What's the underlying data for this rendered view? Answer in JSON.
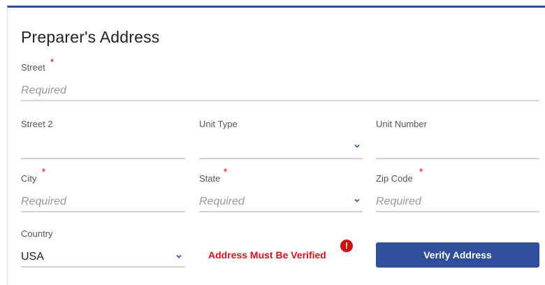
{
  "section": {
    "title": "Preparer's Address"
  },
  "street": {
    "label": "Street",
    "placeholder": "Required"
  },
  "street2": {
    "label": "Street 2"
  },
  "unit_type": {
    "label": "Unit Type"
  },
  "unit_number": {
    "label": "Unit Number"
  },
  "city": {
    "label": "City",
    "placeholder": "Required"
  },
  "state": {
    "label": "State",
    "placeholder": "Required"
  },
  "zip": {
    "label": "Zip Code",
    "placeholder": "Required"
  },
  "country": {
    "label": "Country",
    "value": "USA"
  },
  "required_marker": "*",
  "verification": {
    "error_text": "Address Must Be Verified",
    "error_icon_glyph": "!",
    "button_label": "Verify Address"
  },
  "colors": {
    "accent": "#2f4f9c",
    "error": "#e0101a",
    "required": "#e24a4a"
  }
}
